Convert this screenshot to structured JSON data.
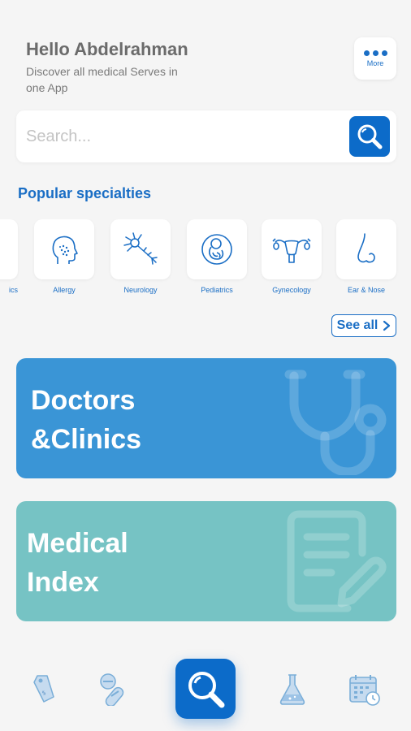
{
  "header": {
    "greeting": "Hello Abdelrahman",
    "subtitle": "Discover all medical Serves in one App"
  },
  "more_button": {
    "label": "More",
    "icon": "dots-icon"
  },
  "search": {
    "placeholder": "Search...",
    "icon": "search-icon"
  },
  "specialties": {
    "title": "Popular specialties",
    "items": [
      {
        "label": "ics",
        "icon": "partial-icon"
      },
      {
        "label": "Allergy",
        "icon": "head-allergy-icon"
      },
      {
        "label": "Neurology",
        "icon": "neuron-icon"
      },
      {
        "label": "Pediatrics",
        "icon": "fetus-icon"
      },
      {
        "label": "Gynecology",
        "icon": "uterus-icon"
      },
      {
        "label": "Ear & Nose",
        "icon": "nose-icon"
      }
    ],
    "see_all": "See all"
  },
  "cards": {
    "doctors": {
      "line1": "Doctors",
      "line2": "&Clinics",
      "icon": "stethoscope-icon",
      "color": "#3a95d6"
    },
    "index": {
      "line1": "Medical",
      "line2": "Index",
      "icon": "document-edit-icon",
      "color": "#76c3c4"
    }
  },
  "nav": {
    "items": [
      "price-tag-icon",
      "pills-icon",
      "search-icon",
      "flask-icon",
      "calendar-clock-icon"
    ],
    "accent": "#0c6bc9"
  }
}
